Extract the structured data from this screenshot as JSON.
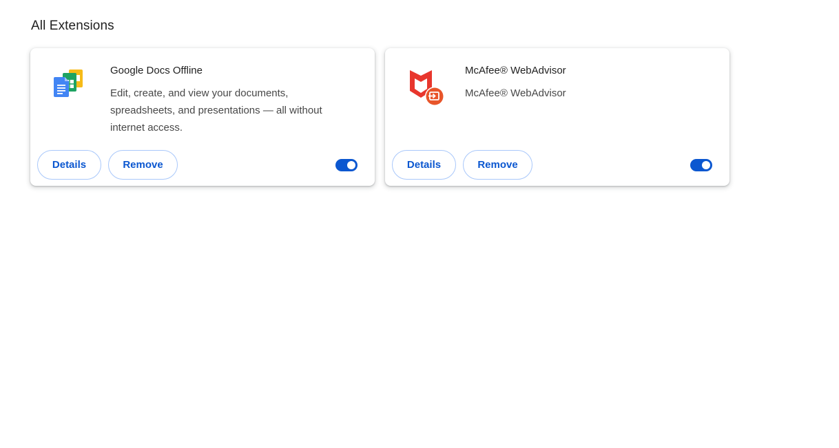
{
  "section": {
    "title": "All Extensions"
  },
  "extensions": [
    {
      "name": "Google Docs Offline",
      "description": "Edit, create, and view your documents, spreadsheets, and presentations — all without internet access.",
      "details_label": "Details",
      "remove_label": "Remove",
      "enabled": true,
      "icon": "google-docs-offline-icon"
    },
    {
      "name": "McAfee® WebAdvisor",
      "description": "McAfee® WebAdvisor",
      "details_label": "Details",
      "remove_label": "Remove",
      "enabled": true,
      "icon": "mcafee-webadvisor-icon"
    }
  ],
  "colors": {
    "accent": "#0b57d0",
    "button_border": "#a8c7fa",
    "mcafee_red": "#e8362d",
    "mcafee_badge": "#e8552a"
  }
}
